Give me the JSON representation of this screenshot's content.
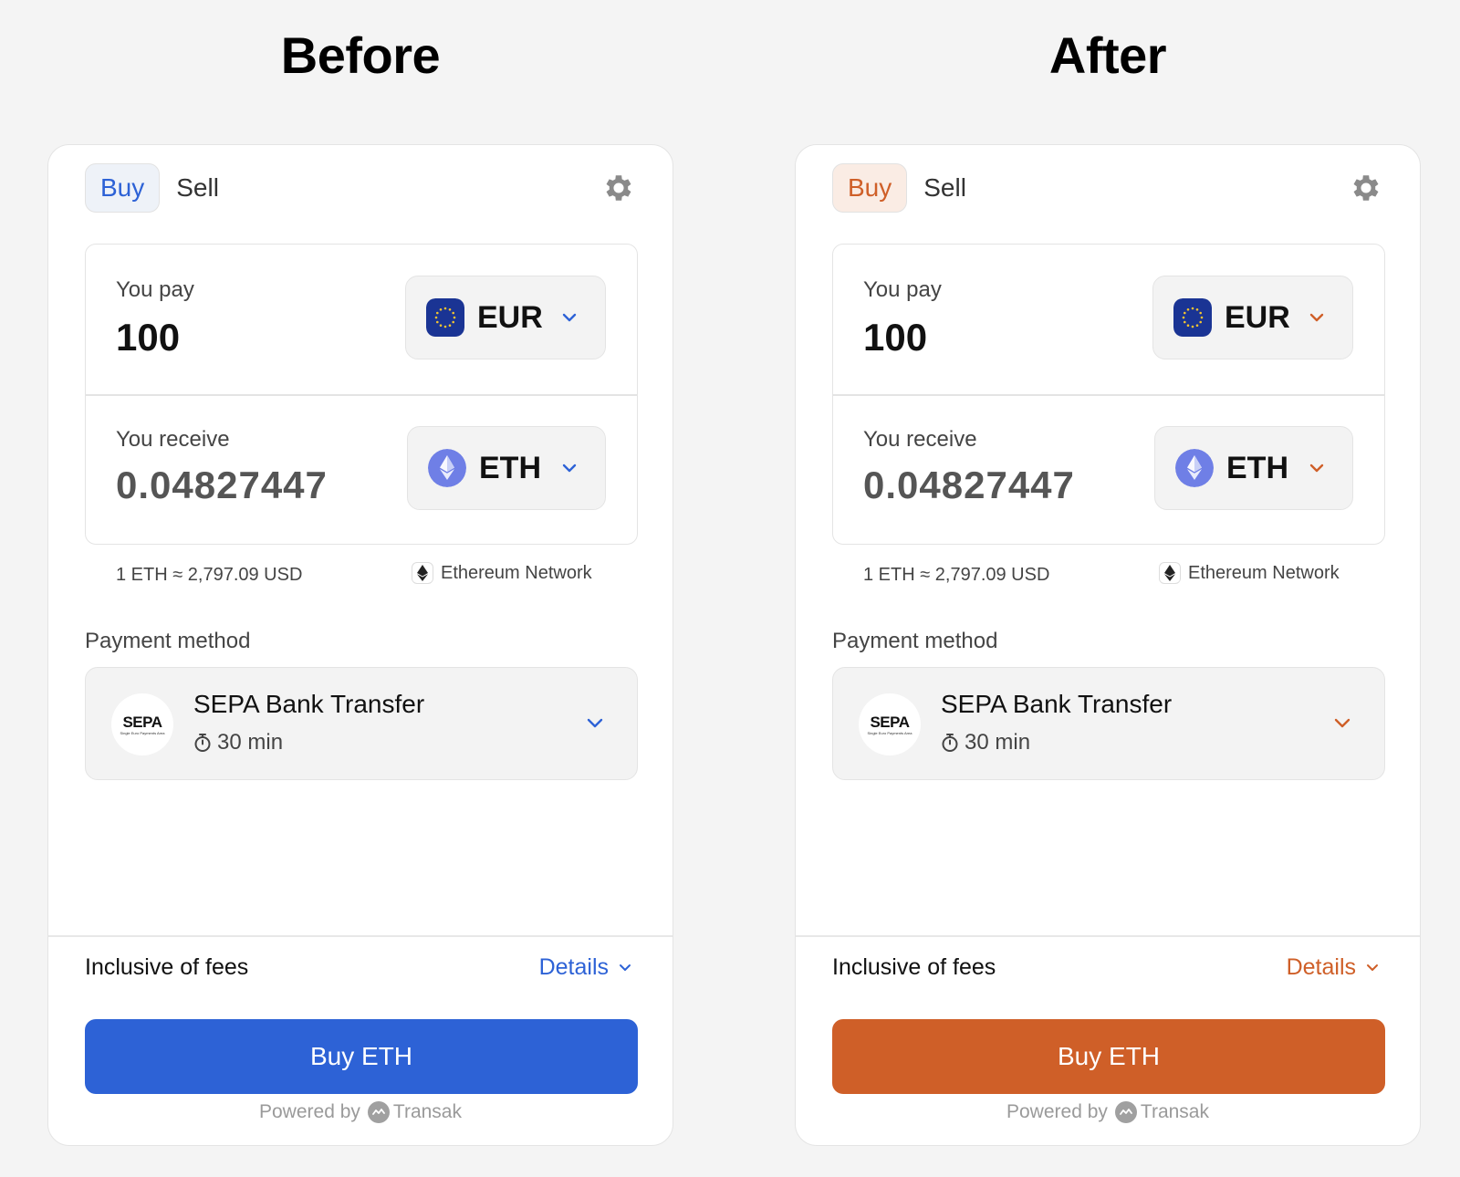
{
  "panels": [
    {
      "heading": "Before",
      "accent": "#2d62d6",
      "accent_soft": "#eef2f8",
      "tabs": {
        "buy": "Buy",
        "sell": "Sell"
      },
      "pay": {
        "label": "You pay",
        "value": "100",
        "currency": "EUR"
      },
      "receive": {
        "label": "You receive",
        "value": "0.04827447",
        "currency": "ETH"
      },
      "rate": "1 ETH ≈ 2,797.09 USD",
      "network": "Ethereum Network",
      "payment_method": {
        "label": "Payment method",
        "name": "SEPA Bank Transfer",
        "time": "30 min",
        "logo_text": "SEPA",
        "logo_sub": "Single Euro Payments Area"
      },
      "fees": {
        "label": "Inclusive of fees",
        "details": "Details"
      },
      "cta": "Buy ETH",
      "powered": {
        "prefix": "Powered by",
        "brand": "Transak"
      },
      "icons": [
        "gear-icon",
        "eu-flag-icon",
        "eth-icon",
        "chevron-down-icon",
        "ethereum-network-icon",
        "sepa-logo",
        "stopwatch-icon",
        "transak-logo"
      ]
    },
    {
      "heading": "After",
      "accent": "#cf5f28",
      "accent_soft": "#faece4",
      "tabs": {
        "buy": "Buy",
        "sell": "Sell"
      },
      "pay": {
        "label": "You pay",
        "value": "100",
        "currency": "EUR"
      },
      "receive": {
        "label": "You receive",
        "value": "0.04827447",
        "currency": "ETH"
      },
      "rate": "1 ETH ≈ 2,797.09 USD",
      "network": "Ethereum Network",
      "payment_method": {
        "label": "Payment method",
        "name": "SEPA Bank Transfer",
        "time": "30 min",
        "logo_text": "SEPA",
        "logo_sub": "Single Euro Payments Area"
      },
      "fees": {
        "label": "Inclusive of fees",
        "details": "Details"
      },
      "cta": "Buy ETH",
      "powered": {
        "prefix": "Powered by",
        "brand": "Transak"
      },
      "icons": [
        "gear-icon",
        "eu-flag-icon",
        "eth-icon",
        "chevron-down-icon",
        "ethereum-network-icon",
        "sepa-logo",
        "stopwatch-icon",
        "transak-logo"
      ]
    }
  ]
}
